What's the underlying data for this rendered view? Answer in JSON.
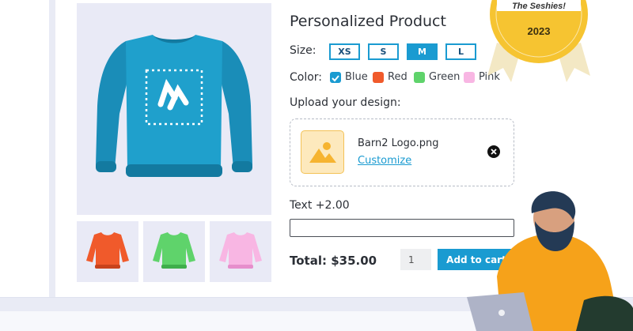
{
  "product": {
    "title": "Personalized Product",
    "size_label": "Size:",
    "sizes": [
      "XS",
      "S",
      "M",
      "L"
    ],
    "selected_size": "M",
    "color_label": "Color:",
    "colors": [
      {
        "name": "Blue",
        "hex": "#1a9bd1",
        "checked": true
      },
      {
        "name": "Red",
        "hex": "#f05a2b",
        "checked": false
      },
      {
        "name": "Green",
        "hex": "#5fd36b",
        "checked": false
      },
      {
        "name": "Pink",
        "hex": "#f8b6e3",
        "checked": false
      }
    ],
    "upload_label": "Upload your design:",
    "uploaded_file": "Barn2 Logo.png",
    "customize_link": "Customize",
    "text_label": "Text +2.00",
    "text_value": "",
    "total": "Total: $35.00",
    "quantity": "1",
    "add_to_cart": "Add to cart"
  },
  "badge": {
    "text": "The Seshies!",
    "year": "2023"
  },
  "colors": {
    "accent": "#1a9bd1",
    "sweater_blue": "#1fa0cc",
    "sweater_red": "#f05a2b",
    "sweater_green": "#5fd36b",
    "sweater_pink": "#f8b6e3",
    "badge_gold": "#f6c431",
    "person_shirt": "#f6a21a"
  },
  "icons": {
    "remove": "close-circle-icon",
    "image": "image-file-icon",
    "check": "checkmark-icon"
  }
}
